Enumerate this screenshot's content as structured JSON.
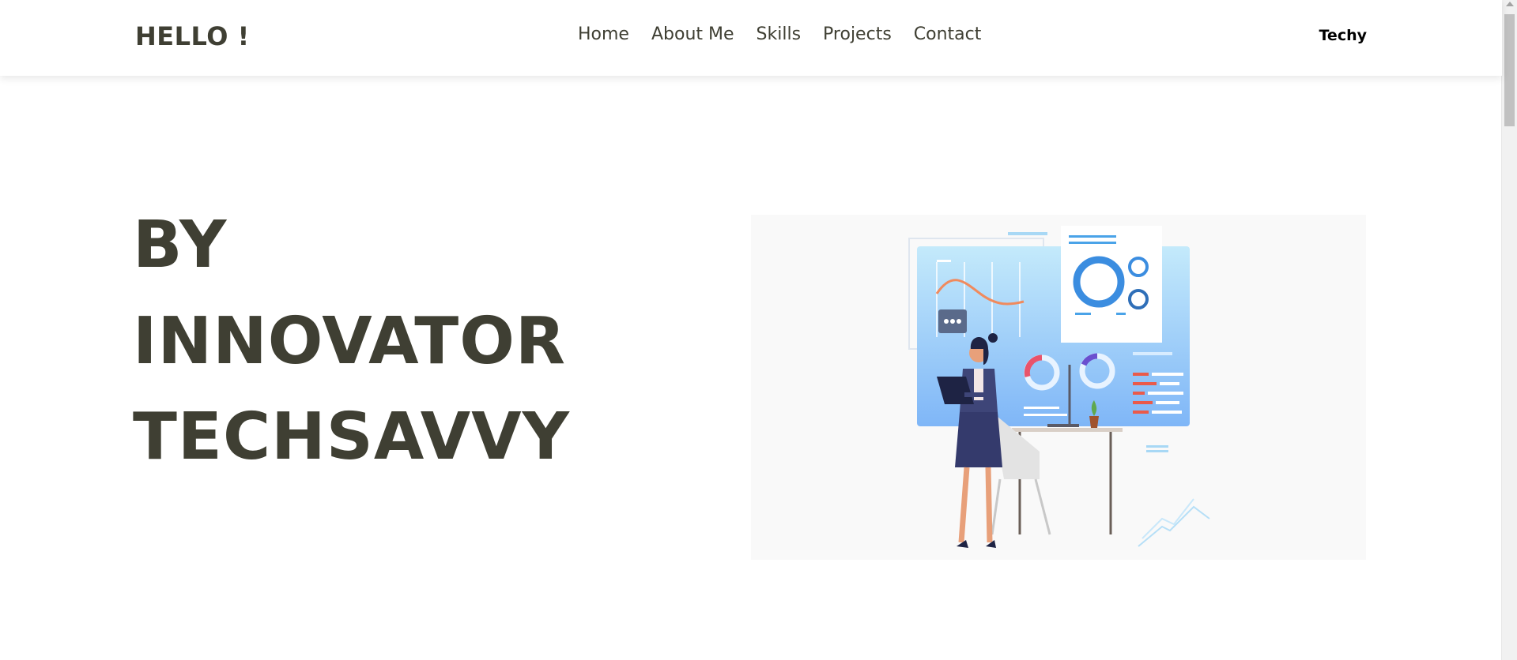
{
  "navbar": {
    "brand": "HELLO !",
    "links": [
      "Home",
      "About Me",
      "Skills",
      "Projects",
      "Contact"
    ],
    "right_label": "Techy"
  },
  "hero": {
    "lines": [
      "BY",
      "INNOVATOR",
      "TECHSAVVY"
    ]
  },
  "colors": {
    "text": "#3f3f33",
    "illustration_bg": "#f9f9f9",
    "screen_blue": "#8ec2fa"
  },
  "icons": {
    "illustration": "woman-with-laptop-dashboard-illustration"
  }
}
